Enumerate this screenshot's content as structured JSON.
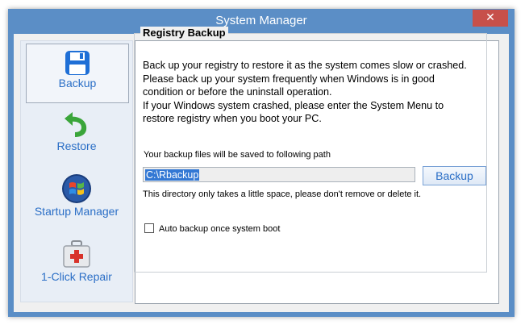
{
  "window": {
    "title": "System Manager",
    "close_icon": "close-icon",
    "close_glyph": "✕"
  },
  "sidebar": {
    "items": [
      {
        "label": "Backup",
        "icon": "floppy-disk-icon",
        "active": true
      },
      {
        "label": "Restore",
        "icon": "green-restore-arrow-icon",
        "active": false
      },
      {
        "label": "Startup Manager",
        "icon": "windows-orb-icon",
        "active": false
      },
      {
        "label": "1-Click Repair",
        "icon": "first-aid-kit-icon",
        "active": false
      }
    ]
  },
  "main": {
    "group_title": "Registry Backup",
    "description": [
      "Back up your registry to restore it as the system comes slow or crashed.",
      "Please back up your system frequently when Windows is in good",
      "condition or before the uninstall operation.",
      "If your Windows system crashed, please enter the System Menu to",
      "restore registry when you boot your PC."
    ],
    "path_label": "Your backup files will be saved to following path",
    "path_value": "C:\\Rbackup",
    "backup_button": "Backup",
    "note": "This directory only takes a little space, please don't remove or delete it.",
    "auto_backup_label": "Auto backup once system boot",
    "auto_backup_checked": false
  },
  "colors": {
    "titlebar": "#5b8ec6",
    "accent": "#2a6ec6",
    "close": "#c7504a"
  }
}
